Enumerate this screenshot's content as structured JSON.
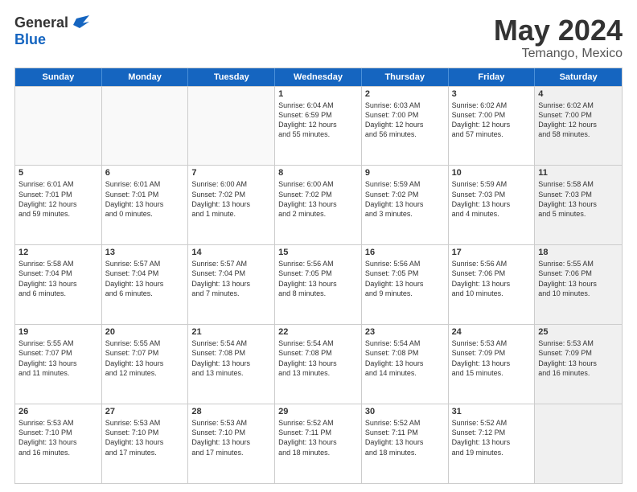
{
  "logo": {
    "general": "General",
    "blue": "Blue"
  },
  "title": "May 2024",
  "location": "Temango, Mexico",
  "days": [
    "Sunday",
    "Monday",
    "Tuesday",
    "Wednesday",
    "Thursday",
    "Friday",
    "Saturday"
  ],
  "rows": [
    [
      {
        "day": "",
        "text": "",
        "empty": true
      },
      {
        "day": "",
        "text": "",
        "empty": true
      },
      {
        "day": "",
        "text": "",
        "empty": true
      },
      {
        "day": "1",
        "text": "Sunrise: 6:04 AM\nSunset: 6:59 PM\nDaylight: 12 hours\nand 55 minutes."
      },
      {
        "day": "2",
        "text": "Sunrise: 6:03 AM\nSunset: 7:00 PM\nDaylight: 12 hours\nand 56 minutes."
      },
      {
        "day": "3",
        "text": "Sunrise: 6:02 AM\nSunset: 7:00 PM\nDaylight: 12 hours\nand 57 minutes."
      },
      {
        "day": "4",
        "text": "Sunrise: 6:02 AM\nSunset: 7:00 PM\nDaylight: 12 hours\nand 58 minutes.",
        "shaded": true
      }
    ],
    [
      {
        "day": "5",
        "text": "Sunrise: 6:01 AM\nSunset: 7:01 PM\nDaylight: 12 hours\nand 59 minutes."
      },
      {
        "day": "6",
        "text": "Sunrise: 6:01 AM\nSunset: 7:01 PM\nDaylight: 13 hours\nand 0 minutes."
      },
      {
        "day": "7",
        "text": "Sunrise: 6:00 AM\nSunset: 7:02 PM\nDaylight: 13 hours\nand 1 minute."
      },
      {
        "day": "8",
        "text": "Sunrise: 6:00 AM\nSunset: 7:02 PM\nDaylight: 13 hours\nand 2 minutes."
      },
      {
        "day": "9",
        "text": "Sunrise: 5:59 AM\nSunset: 7:02 PM\nDaylight: 13 hours\nand 3 minutes."
      },
      {
        "day": "10",
        "text": "Sunrise: 5:59 AM\nSunset: 7:03 PM\nDaylight: 13 hours\nand 4 minutes."
      },
      {
        "day": "11",
        "text": "Sunrise: 5:58 AM\nSunset: 7:03 PM\nDaylight: 13 hours\nand 5 minutes.",
        "shaded": true
      }
    ],
    [
      {
        "day": "12",
        "text": "Sunrise: 5:58 AM\nSunset: 7:04 PM\nDaylight: 13 hours\nand 6 minutes."
      },
      {
        "day": "13",
        "text": "Sunrise: 5:57 AM\nSunset: 7:04 PM\nDaylight: 13 hours\nand 6 minutes."
      },
      {
        "day": "14",
        "text": "Sunrise: 5:57 AM\nSunset: 7:04 PM\nDaylight: 13 hours\nand 7 minutes."
      },
      {
        "day": "15",
        "text": "Sunrise: 5:56 AM\nSunset: 7:05 PM\nDaylight: 13 hours\nand 8 minutes."
      },
      {
        "day": "16",
        "text": "Sunrise: 5:56 AM\nSunset: 7:05 PM\nDaylight: 13 hours\nand 9 minutes."
      },
      {
        "day": "17",
        "text": "Sunrise: 5:56 AM\nSunset: 7:06 PM\nDaylight: 13 hours\nand 10 minutes."
      },
      {
        "day": "18",
        "text": "Sunrise: 5:55 AM\nSunset: 7:06 PM\nDaylight: 13 hours\nand 10 minutes.",
        "shaded": true
      }
    ],
    [
      {
        "day": "19",
        "text": "Sunrise: 5:55 AM\nSunset: 7:07 PM\nDaylight: 13 hours\nand 11 minutes."
      },
      {
        "day": "20",
        "text": "Sunrise: 5:55 AM\nSunset: 7:07 PM\nDaylight: 13 hours\nand 12 minutes."
      },
      {
        "day": "21",
        "text": "Sunrise: 5:54 AM\nSunset: 7:08 PM\nDaylight: 13 hours\nand 13 minutes."
      },
      {
        "day": "22",
        "text": "Sunrise: 5:54 AM\nSunset: 7:08 PM\nDaylight: 13 hours\nand 13 minutes."
      },
      {
        "day": "23",
        "text": "Sunrise: 5:54 AM\nSunset: 7:08 PM\nDaylight: 13 hours\nand 14 minutes."
      },
      {
        "day": "24",
        "text": "Sunrise: 5:53 AM\nSunset: 7:09 PM\nDaylight: 13 hours\nand 15 minutes."
      },
      {
        "day": "25",
        "text": "Sunrise: 5:53 AM\nSunset: 7:09 PM\nDaylight: 13 hours\nand 16 minutes.",
        "shaded": true
      }
    ],
    [
      {
        "day": "26",
        "text": "Sunrise: 5:53 AM\nSunset: 7:10 PM\nDaylight: 13 hours\nand 16 minutes."
      },
      {
        "day": "27",
        "text": "Sunrise: 5:53 AM\nSunset: 7:10 PM\nDaylight: 13 hours\nand 17 minutes."
      },
      {
        "day": "28",
        "text": "Sunrise: 5:53 AM\nSunset: 7:10 PM\nDaylight: 13 hours\nand 17 minutes."
      },
      {
        "day": "29",
        "text": "Sunrise: 5:52 AM\nSunset: 7:11 PM\nDaylight: 13 hours\nand 18 minutes."
      },
      {
        "day": "30",
        "text": "Sunrise: 5:52 AM\nSunset: 7:11 PM\nDaylight: 13 hours\nand 18 minutes."
      },
      {
        "day": "31",
        "text": "Sunrise: 5:52 AM\nSunset: 7:12 PM\nDaylight: 13 hours\nand 19 minutes."
      },
      {
        "day": "",
        "text": "",
        "empty": true,
        "shaded": true
      }
    ]
  ]
}
